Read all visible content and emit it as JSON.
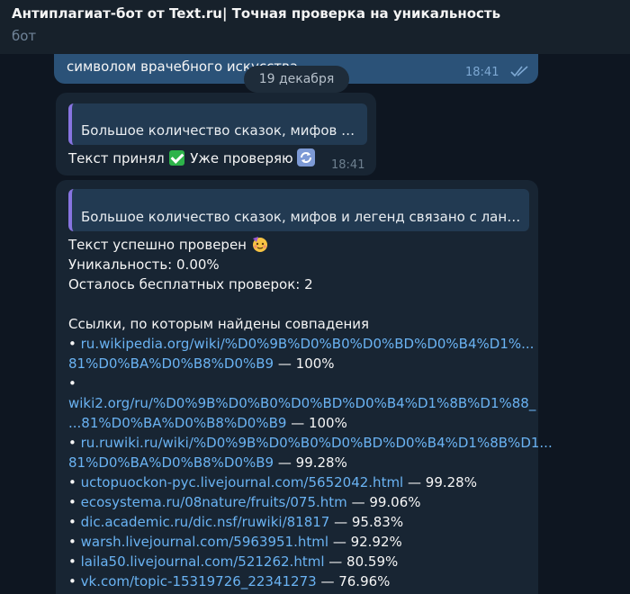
{
  "header": {
    "title": "Антиплагиат-бот от Text.ru| Точная проверка на уникальность",
    "subtitle": "бот"
  },
  "chat": {
    "date_separator": "19 декабря",
    "prev_message": {
      "text_tail": "символом врачебного искусства.",
      "time": "18:41"
    },
    "msg1": {
      "quote": "Большое количество сказок, мифов и...",
      "text_a": "Текст принял",
      "text_b": "Уже проверяю",
      "time": "18:41"
    },
    "msg2": {
      "quote": "Большое количество сказок, мифов и легенд связано с ланд...",
      "line1": "Текст успешно проверен",
      "line2": "Уникальность: 0.00%",
      "line3": "Осталось бесплатных проверок: 2",
      "links_header": "Ссылки, по которым найдены совпадения",
      "links": [
        {
          "bullet": "•",
          "url": "ru.wikipedia.org/wiki/%D0%9B%D0%B0%D0%BD%D0%B4%D1%...",
          "url2": "81%D0%BA%D0%B8%D0%B9",
          "pct": "— 100%"
        },
        {
          "bullet": "•",
          "url": "",
          "url2": "wiki2.org/ru/%D0%9B%D0%B0%D0%BD%D0%B4%D1%8B%D1%88_",
          "url3": "...81%D0%BA%D0%B8%D0%B9",
          "pct": "— 100%"
        },
        {
          "bullet": "•",
          "url": "ru.ruwiki.ru/wiki/%D0%9B%D0%B0%D0%BD%D0%B4%D1%8B%D1...",
          "url2": "81%D0%BA%D0%B8%D0%B9",
          "pct": "— 99.28%"
        },
        {
          "bullet": "•",
          "url": "uctopuockon-pyc.livejournal.com/5652042.html",
          "pct": "— 99.28%"
        },
        {
          "bullet": "•",
          "url": "ecosystema.ru/08nature/fruits/075.htm",
          "pct": "— 99.06%"
        },
        {
          "bullet": "•",
          "url": "dic.academic.ru/dic.nsf/ruwiki/81817",
          "pct": "— 95.83%"
        },
        {
          "bullet": "•",
          "url": "warsh.livejournal.com/5963951.html",
          "pct": "— 92.92%"
        },
        {
          "bullet": "•",
          "url": "laila50.livejournal.com/521262.html",
          "pct": "— 80.59%"
        },
        {
          "bullet": "•",
          "url": "vk.com/topic-15319726_22341273",
          "pct": "— 76.96%"
        }
      ]
    }
  },
  "colors": {
    "background": "#0e1621",
    "bubble_in": "#182533",
    "bubble_out": "#2b5278",
    "link": "#6ab3f3",
    "quote_accent": "#8774e1"
  },
  "icons": [
    "double-check-icon",
    "check-mark-emoji",
    "refresh-emoji",
    "party-face-emoji"
  ]
}
